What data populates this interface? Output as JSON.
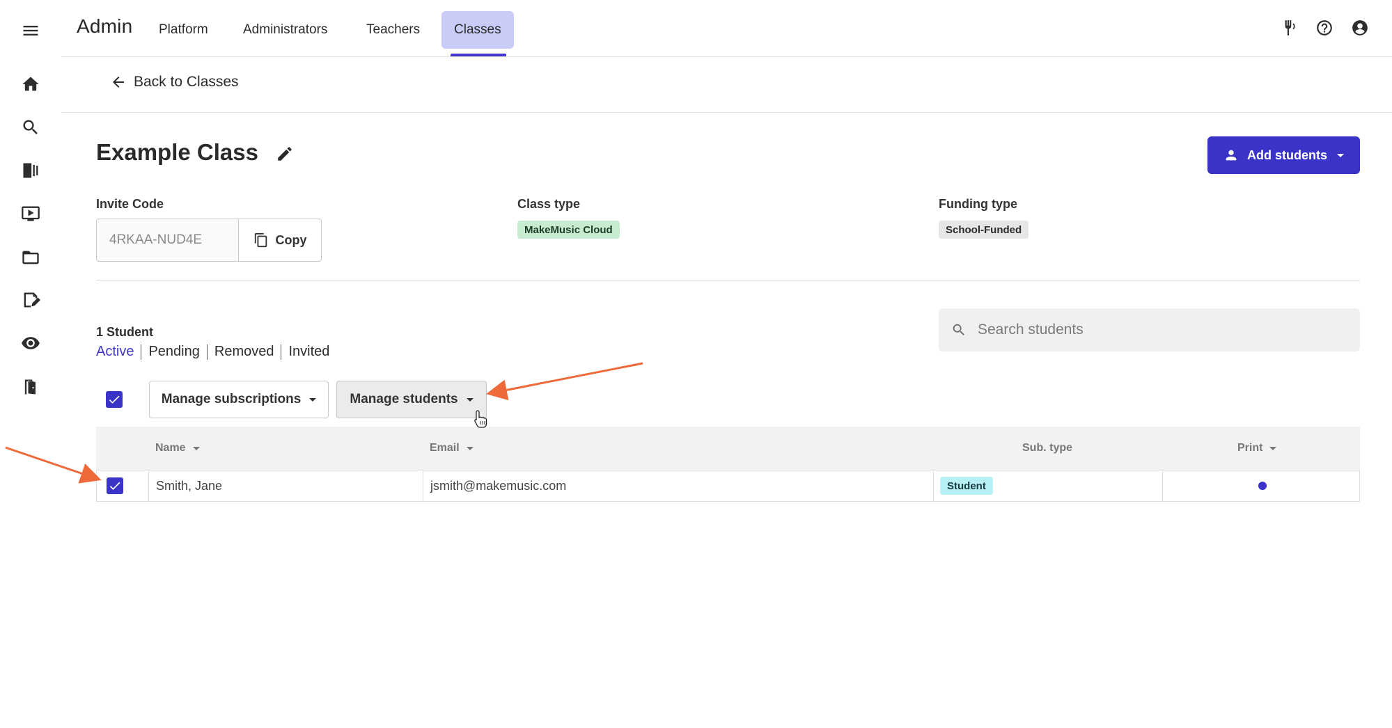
{
  "app": {
    "title": "Admin"
  },
  "nav": {
    "items": [
      {
        "label": "Platform"
      },
      {
        "label": "Administrators"
      },
      {
        "label": "Teachers"
      },
      {
        "label": "Classes",
        "active": true
      }
    ]
  },
  "rail": {
    "icons": [
      "menu-icon",
      "home-icon",
      "search-icon",
      "library-icon",
      "video-icon",
      "folder-icon",
      "assignment-icon",
      "eye-icon",
      "exit-icon"
    ]
  },
  "topbar": {
    "icons": [
      "tuner-icon",
      "help-icon",
      "account-icon"
    ]
  },
  "back": {
    "label": "Back to Classes"
  },
  "class": {
    "title": "Example Class",
    "invite_code_label": "Invite Code",
    "invite_code": "4RKAA-NUD4E",
    "copy_label": "Copy",
    "class_type_label": "Class type",
    "class_type": "MakeMusic Cloud",
    "funding_type_label": "Funding type",
    "funding_type": "School-Funded"
  },
  "actions": {
    "add_students_label": "Add students"
  },
  "students": {
    "count_label": "1 Student",
    "filters": [
      "Active",
      "Pending",
      "Removed",
      "Invited"
    ],
    "active_filter": "Active",
    "search_placeholder": "Search students",
    "manage_subscriptions_label": "Manage subscriptions",
    "manage_students_label": "Manage students",
    "select_all_checked": true
  },
  "table": {
    "columns": [
      "Name",
      "Email",
      "Sub. type",
      "Print"
    ],
    "rows": [
      {
        "name": "Smith, Jane",
        "email": "jsmith@makemusic.com",
        "sub_type": "Student",
        "print": true,
        "checked": true
      }
    ]
  },
  "colors": {
    "accent": "#3a33c7",
    "active_tab_bg": "#c8ccf7",
    "class_type_badge": "#c7ecd0",
    "funding_badge": "#e6e6e6",
    "sub_type_badge": "#b6f0f5",
    "annotation_arrow": "#ef6a3a"
  }
}
